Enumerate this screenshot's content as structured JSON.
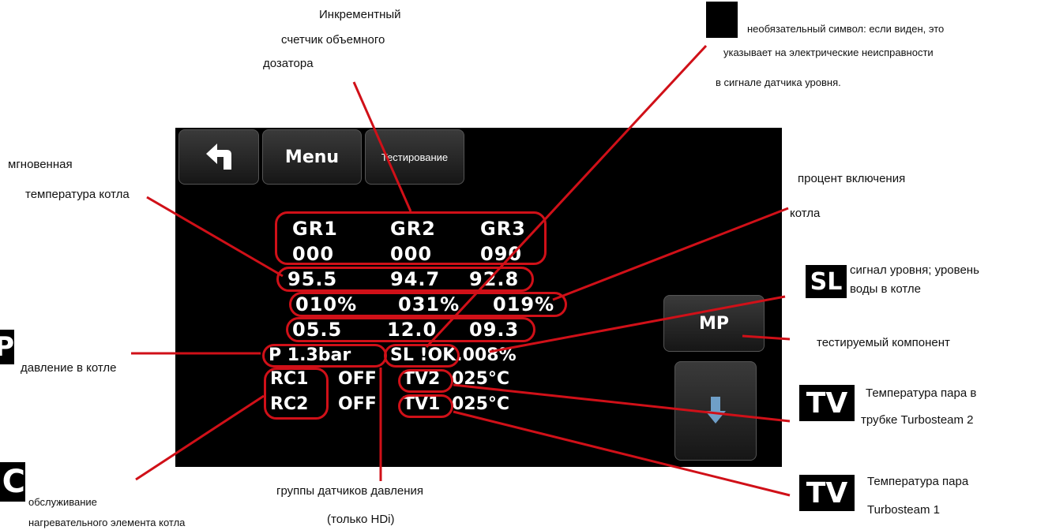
{
  "annotations": {
    "incremental_counter": [
      "Инкрементный",
      "счетчик объемного",
      "дозатора"
    ],
    "optional_symbol": [
      "необязательный символ: если виден, это",
      "указывает на электрические неисправности",
      "в сигнале датчика уровня."
    ],
    "instant_temp": [
      "мгновенная",
      "температура котла"
    ],
    "percent_on": [
      "процент включения",
      "котла"
    ],
    "level_signal": [
      "сигнал уровня; уровень",
      "воды в котле"
    ],
    "tested_component": "тестируемый компонент",
    "pressure": "давление в котле",
    "tv2_temp": [
      "Температура пара в",
      "трубке Turbosteam 2"
    ],
    "tv1_temp": [
      "Температура пара",
      "Turbosteam 1"
    ],
    "heater_service": [
      "обслуживание",
      "нагревательного элемента котла"
    ],
    "pressure_groups": [
      "группы датчиков давления",
      "(только HDi)"
    ]
  },
  "icons": {
    "p_icon": "P",
    "sl_icon": "SL",
    "tv2_icon": "TV",
    "tv1_icon": "TV",
    "rc_icon": "C"
  },
  "toolbar": {
    "menu_label": "Menu",
    "test_label": "Тестирование"
  },
  "screen": {
    "gr_headers": [
      "GR1",
      "GR2",
      "GR3"
    ],
    "counters": [
      "000",
      "000",
      "090"
    ],
    "temps": [
      "95.5",
      "94.7",
      "92.8"
    ],
    "percents": [
      "010%",
      "031%",
      "019%"
    ],
    "values": [
      "05.5",
      "12.0",
      "09.3"
    ],
    "pressure": "P 1.3bar",
    "level": "SL !OK.008%",
    "rc1": "RC1",
    "rc1_state": "OFF",
    "rc2": "RC2",
    "rc2_state": "OFF",
    "tv2": "TV2",
    "tv2_value": "025°C",
    "tv1": "TV1",
    "tv1_value": "025°C",
    "mp_label": "MP"
  },
  "colors": {
    "accent_red": "#d01018",
    "screen_bg": "#000000"
  }
}
